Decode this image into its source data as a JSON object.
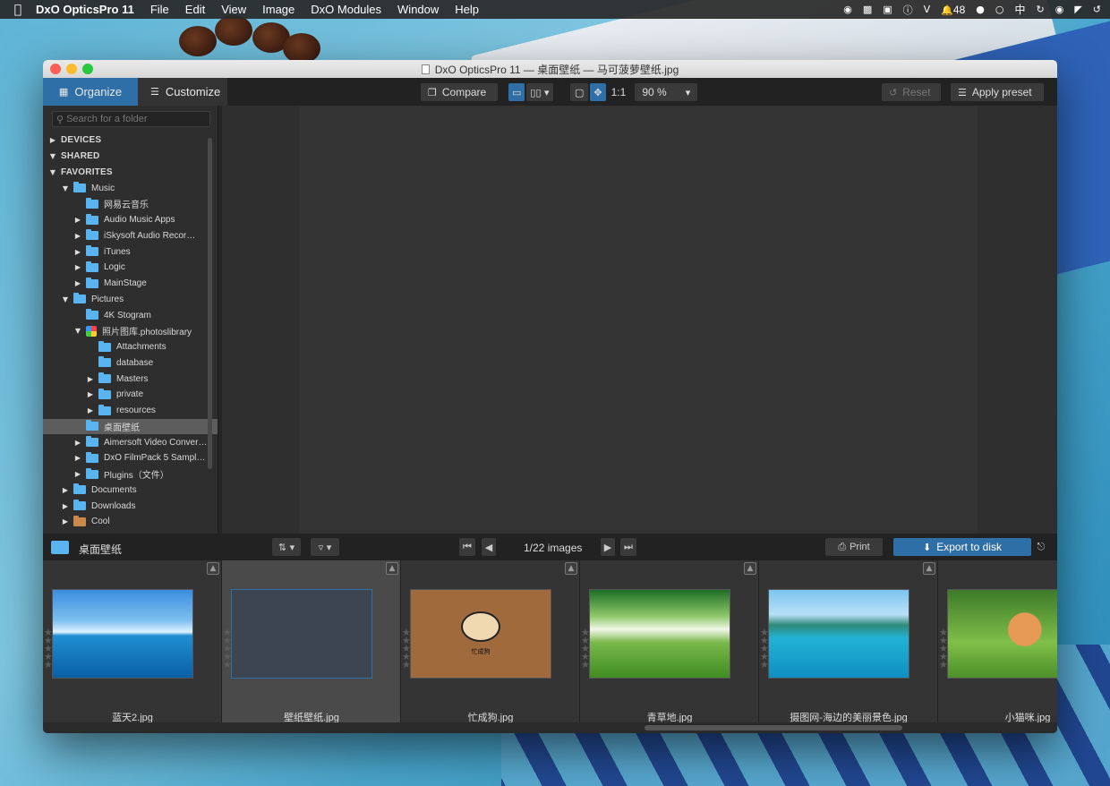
{
  "menubar": {
    "apple": "",
    "app_name": "DxO OpticsPro 11",
    "items": [
      "File",
      "Edit",
      "View",
      "Image",
      "DxO Modules",
      "Window",
      "Help"
    ],
    "status": {
      "notification_count": "48",
      "input_method": "中"
    }
  },
  "window": {
    "title": "DxO OpticsPro 11 — 桌面壁纸 — 马可菠萝壁纸.jpg"
  },
  "toolbar": {
    "organize_label": "Organize",
    "customize_label": "Customize",
    "compare_label": "Compare",
    "one_to_one_label": "1:1",
    "zoom_value": "90 %",
    "reset_label": "Reset",
    "apply_preset_label": "Apply preset"
  },
  "sidebar": {
    "search_placeholder": "Search for a folder",
    "tree": [
      {
        "label": "DEVICES",
        "level": 0,
        "disc": "▶",
        "kind": "section"
      },
      {
        "label": "SHARED",
        "level": 0,
        "disc": "▼",
        "kind": "section"
      },
      {
        "label": "FAVORITES",
        "level": 0,
        "disc": "▼",
        "kind": "section"
      },
      {
        "label": "Music",
        "level": 1,
        "disc": "▼",
        "kind": "folder"
      },
      {
        "label": "网易云音乐",
        "level": 2,
        "disc": "",
        "kind": "folder"
      },
      {
        "label": "Audio Music Apps",
        "level": 2,
        "disc": "▶",
        "kind": "folder"
      },
      {
        "label": "iSkysoft Audio Recor…",
        "level": 2,
        "disc": "▶",
        "kind": "folder"
      },
      {
        "label": "iTunes",
        "level": 2,
        "disc": "▶",
        "kind": "folder"
      },
      {
        "label": "Logic",
        "level": 2,
        "disc": "▶",
        "kind": "folder"
      },
      {
        "label": "MainStage",
        "level": 2,
        "disc": "▶",
        "kind": "folder"
      },
      {
        "label": "Pictures",
        "level": 1,
        "disc": "▼",
        "kind": "folder"
      },
      {
        "label": "4K Stogram",
        "level": 2,
        "disc": "",
        "kind": "folder"
      },
      {
        "label": "照片图库.photoslibrary",
        "level": 2,
        "disc": "▼",
        "kind": "photolib"
      },
      {
        "label": "Attachments",
        "level": 3,
        "disc": "",
        "kind": "folder"
      },
      {
        "label": "database",
        "level": 3,
        "disc": "",
        "kind": "folder"
      },
      {
        "label": "Masters",
        "level": 3,
        "disc": "▶",
        "kind": "folder"
      },
      {
        "label": "private",
        "level": 3,
        "disc": "▶",
        "kind": "folder"
      },
      {
        "label": "resources",
        "level": 3,
        "disc": "▶",
        "kind": "folder"
      },
      {
        "label": "桌面壁纸",
        "level": 2,
        "disc": "",
        "kind": "folder",
        "selected": true
      },
      {
        "label": "Aimersoft Video Conver…",
        "level": 2,
        "disc": "▶",
        "kind": "folder"
      },
      {
        "label": "DxO FilmPack 5 Sampl…",
        "level": 2,
        "disc": "▶",
        "kind": "folder"
      },
      {
        "label": "Plugins（文件）",
        "level": 2,
        "disc": "▶",
        "kind": "folder"
      },
      {
        "label": "Documents",
        "level": 1,
        "disc": "▶",
        "kind": "folder"
      },
      {
        "label": "Downloads",
        "level": 1,
        "disc": "▶",
        "kind": "folder"
      },
      {
        "label": "Cool",
        "level": 1,
        "disc": "▶",
        "kind": "home"
      }
    ]
  },
  "filmbar": {
    "folder_name": "桌面壁纸",
    "image_count": "1/22 images",
    "print_label": "Print",
    "export_label": "Export to disk"
  },
  "filmstrip": {
    "items": [
      {
        "filename": "蓝天2.jpg",
        "image": "sky",
        "selected": false
      },
      {
        "filename": "壁纸壁纸.jpg",
        "image": "blank",
        "selected": true
      },
      {
        "filename": "忙成狗.jpg",
        "image": "dog",
        "selected": false
      },
      {
        "filename": "青草地.jpg",
        "image": "grass",
        "selected": false
      },
      {
        "filename": "摄图网-海边的美丽景色.jpg",
        "image": "beach",
        "selected": false
      },
      {
        "filename": "小猫咪.jpg",
        "image": "cat",
        "selected": false
      }
    ],
    "dog_caption": "忙成狗"
  },
  "colors": {
    "accent": "#2f6fa8",
    "folder": "#5ab4f0",
    "panel": "#2b2b2b"
  }
}
